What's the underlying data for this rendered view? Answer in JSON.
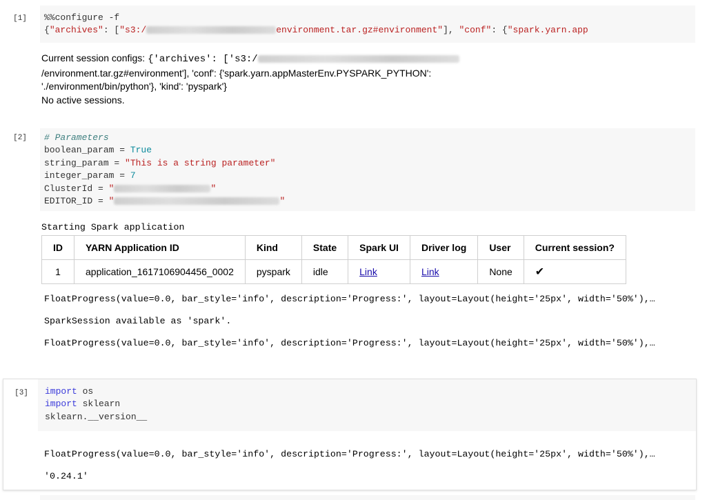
{
  "cells": [
    {
      "prompt": "[1]",
      "code": {
        "line1": "%%configure -f",
        "line2_open": "{",
        "line2_key1": "\"archives\"",
        "line2_sep1": ": [",
        "line2_s3": "\"s3:/",
        "line2_env": "environment.tar.gz#environment\"",
        "line2_sep2": "], ",
        "line2_key2": "\"conf\"",
        "line2_sep3": ": {",
        "line2_app": "\"spark.yarn.app"
      },
      "output": {
        "prefix": "Current session configs: ",
        "l1_code": "{'archives': ['s3:/",
        "l2_code": "/environment.tar.gz#environment'], 'conf': {'spark.yarn.appMasterEnv.PYSPARK_PYTHON':",
        "l3_code": "'./environment/bin/python'}, 'kind': 'pyspark'}",
        "no_sessions": "No active sessions."
      }
    },
    {
      "prompt": "[2]",
      "code": {
        "comment": "# Parameters",
        "bool_name": "boolean_param = ",
        "bool_val": "True",
        "str_name": "string_param = ",
        "str_val": "\"This is a string parameter\"",
        "int_name": "integer_param = ",
        "int_val": "7",
        "cluster_name": "ClusterId = ",
        "cluster_quote": "\"",
        "editor_name": "EDITOR_ID = ",
        "editor_quote": "\""
      },
      "output": {
        "starting": "Starting Spark application",
        "table": {
          "headers": [
            "ID",
            "YARN Application ID",
            "Kind",
            "State",
            "Spark UI",
            "Driver log",
            "User",
            "Current session?"
          ],
          "row": {
            "id": "1",
            "app_id": "application_1617106904456_0002",
            "kind": "pyspark",
            "state": "idle",
            "spark_ui": "Link",
            "driver_log": "Link",
            "user": "None",
            "current": "✔"
          }
        },
        "progress1": "FloatProgress(value=0.0, bar_style='info', description='Progress:', layout=Layout(height='25px', width='50%'),…",
        "spark_avail": "SparkSession available as 'spark'.",
        "progress2": "FloatProgress(value=0.0, bar_style='info', description='Progress:', layout=Layout(height='25px', width='50%'),…"
      }
    },
    {
      "prompt": "[3]",
      "code": {
        "import_kw": "import",
        "import1_mod": " os",
        "import2_mod": " sklearn",
        "version_line": "sklearn.__version__"
      },
      "output": {
        "progress": "FloatProgress(value=0.0, bar_style='info', description='Progress:', layout=Layout(height='25px', width='50%'),…",
        "result": "'0.24.1'"
      }
    }
  ]
}
